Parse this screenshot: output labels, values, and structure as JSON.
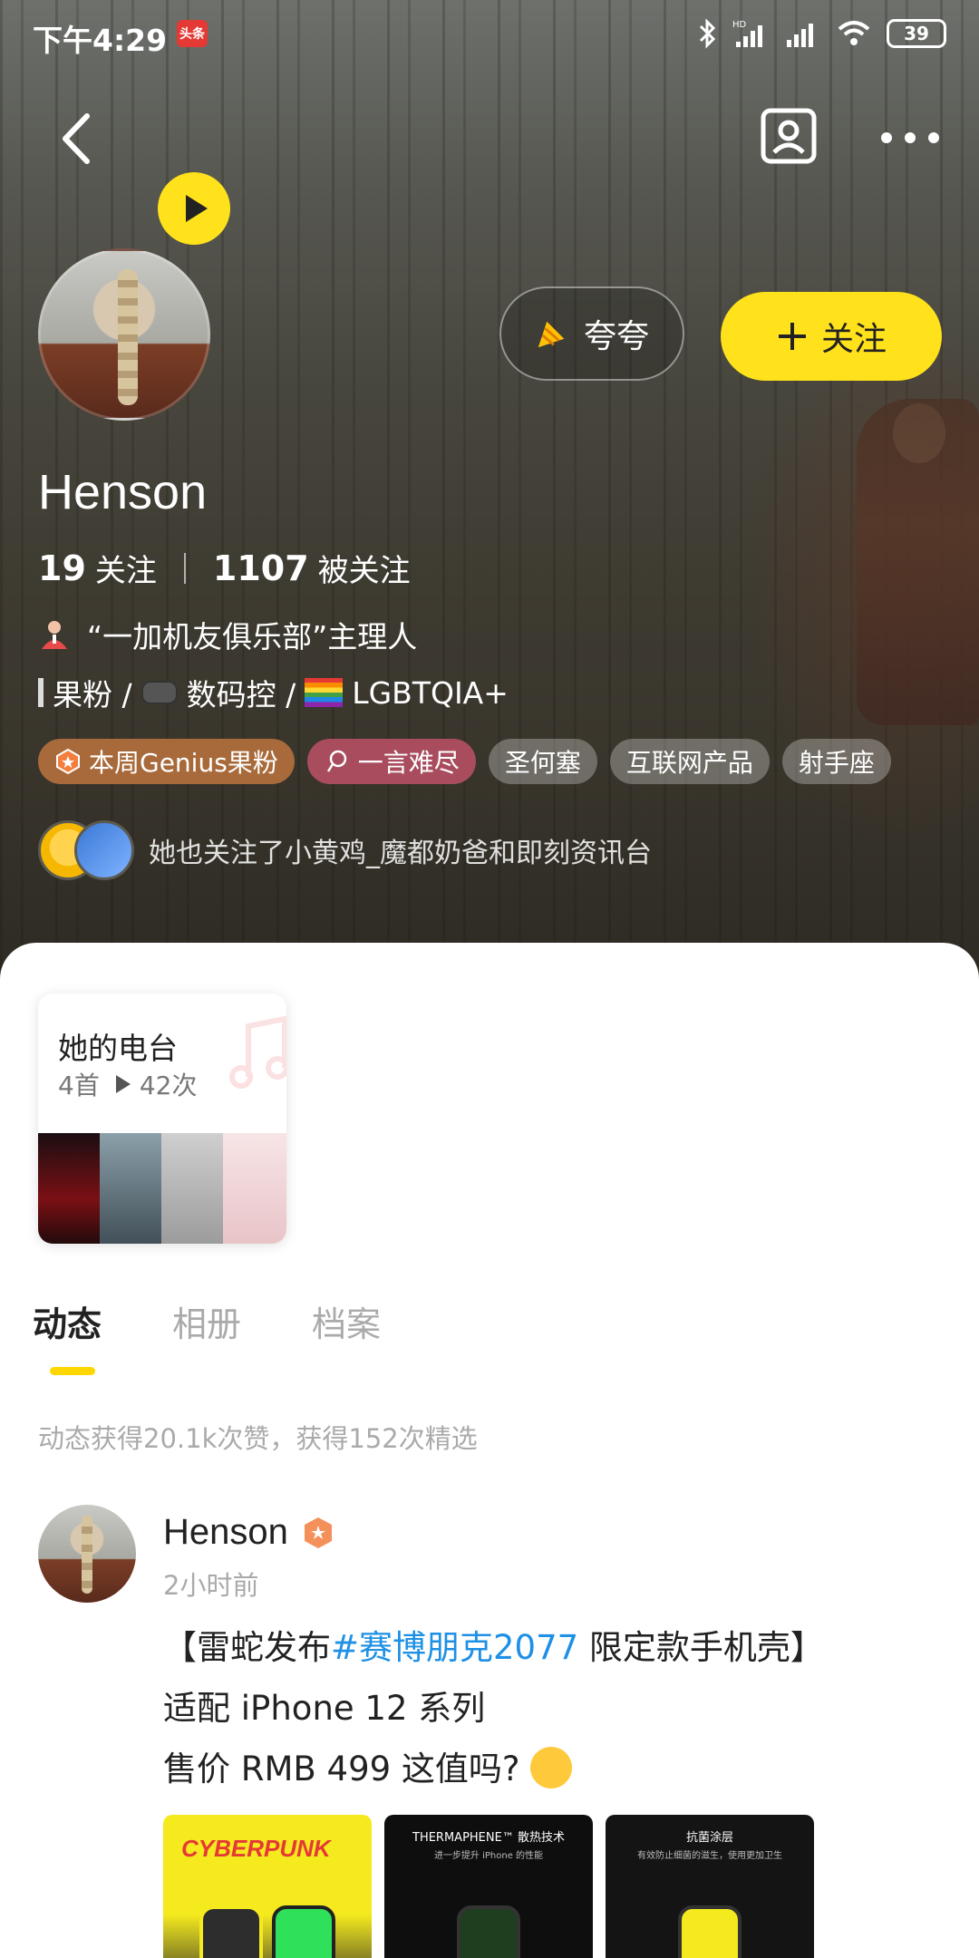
{
  "status_bar": {
    "time": "下午4:29",
    "app_badge": "头条",
    "battery": "39"
  },
  "header": {
    "back_icon": "back-arrow-icon",
    "card_icon": "profile-card-icon",
    "more_icon": "more-dots-icon"
  },
  "profile": {
    "name": "Henson",
    "following_count": "19",
    "following_label": "关注",
    "followers_count": "1107",
    "followers_label": "被关注",
    "role": "“一加机友俱乐部”主理人",
    "tag_line": {
      "t1": "果粉 / ",
      "t2": "数码控 / ",
      "t3": "LGBTQIA+"
    },
    "chips": [
      "本周Genius果粉",
      "一言难尽",
      "圣何塞",
      "互联网产品",
      "射手座"
    ],
    "mutual_text": "她也关注了小黄鸡_魔都奶爸和即刻资讯台"
  },
  "actions": {
    "praise_label": "夸夸",
    "follow_label": "关注"
  },
  "radio": {
    "title": "她的电台",
    "tracks": "4首",
    "plays": "42次"
  },
  "tabs": [
    "动态",
    "相册",
    "档案"
  ],
  "summary": "动态获得20.1k次赞，获得152次精选",
  "post": {
    "author": "Henson",
    "time": "2小时前",
    "line1_a": "【雷蛇发布",
    "line1_tag": "#赛博朋克2077",
    "line1_b": " 限定款手机壳】",
    "line2": "适配 iPhone 12 系列",
    "line3": "售价 RMB 499 这值吗?",
    "thumb1_text": "CYBERPUNK",
    "thumb2_title": "THERMAPHENE™ 散热技术",
    "thumb2_sub": "进一步提升 iPhone 的性能",
    "thumb3_title": "抗菌涂层",
    "thumb3_sub": "有效防止细菌的滋生，使用更加卫生"
  },
  "colors": {
    "accent": "#ffe21b",
    "hashtag": "#1e90e5",
    "genius_chip": "#a86a3a",
    "quote_chip": "#a94d5e"
  }
}
